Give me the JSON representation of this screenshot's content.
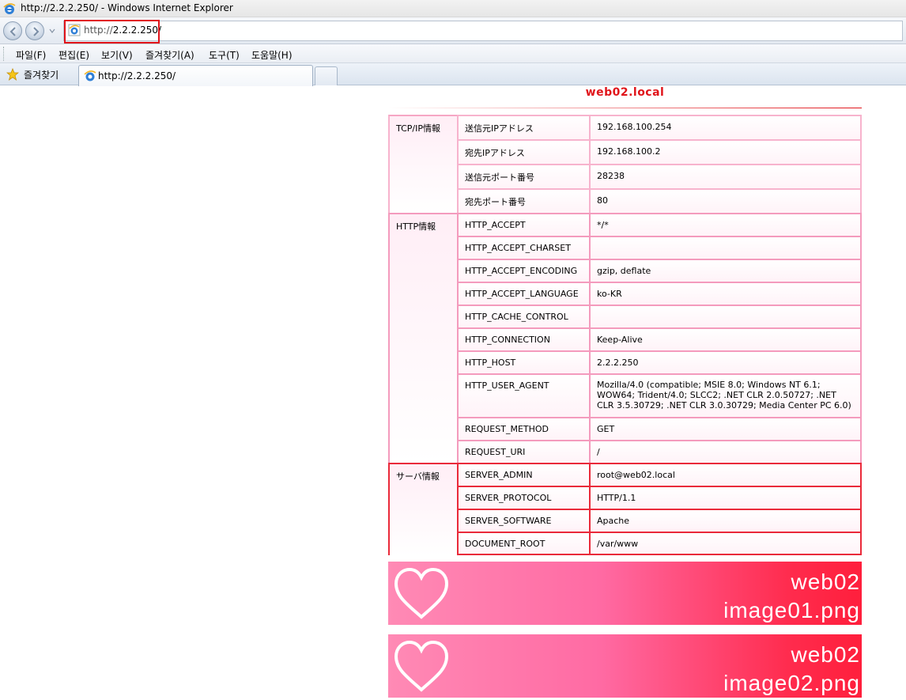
{
  "window": {
    "title": "http://2.2.2.250/ - Windows Internet Explorer"
  },
  "address_bar": {
    "url_scheme": "http://",
    "url_host": "2.2.2.250/"
  },
  "menu": {
    "items": [
      "파일(F)",
      "편집(E)",
      "보기(V)",
      "즐겨찾기(A)",
      "도구(T)",
      "도움말(H)"
    ]
  },
  "favorites": {
    "label": "즐겨찾기"
  },
  "tab": {
    "label": "http://2.2.2.250/"
  },
  "page": {
    "title": "web02.local",
    "sections": {
      "tcp": {
        "label": "TCP/IP情報",
        "rows": [
          {
            "key": "送信元IPアドレス",
            "value": "192.168.100.254"
          },
          {
            "key": "宛先IPアドレス",
            "value": "192.168.100.2"
          },
          {
            "key": "送信元ポート番号",
            "value": "28238"
          },
          {
            "key": "宛先ポート番号",
            "value": "80"
          }
        ]
      },
      "http": {
        "label": "HTTP情報",
        "rows": [
          {
            "key": "HTTP_ACCEPT",
            "value": "*/*"
          },
          {
            "key": "HTTP_ACCEPT_CHARSET",
            "value": ""
          },
          {
            "key": "HTTP_ACCEPT_ENCODING",
            "value": "gzip, deflate"
          },
          {
            "key": "HTTP_ACCEPT_LANGUAGE",
            "value": "ko-KR"
          },
          {
            "key": "HTTP_CACHE_CONTROL",
            "value": ""
          },
          {
            "key": "HTTP_CONNECTION",
            "value": "Keep-Alive"
          },
          {
            "key": "HTTP_HOST",
            "value": "2.2.2.250"
          },
          {
            "key": "HTTP_USER_AGENT",
            "value": "Mozilla/4.0 (compatible; MSIE 8.0; Windows NT 6.1; WOW64; Trident/4.0; SLCC2; .NET CLR 2.0.50727; .NET CLR 3.5.30729; .NET CLR 3.0.30729; Media Center PC 6.0)"
          },
          {
            "key": "REQUEST_METHOD",
            "value": "GET"
          },
          {
            "key": "REQUEST_URI",
            "value": "/"
          }
        ]
      },
      "server": {
        "label": "サーバ情報",
        "rows": [
          {
            "key": "SERVER_ADMIN",
            "value": "root@web02.local"
          },
          {
            "key": "SERVER_PROTOCOL",
            "value": "HTTP/1.1"
          },
          {
            "key": "SERVER_SOFTWARE",
            "value": "Apache"
          },
          {
            "key": "DOCUMENT_ROOT",
            "value": "/var/www"
          }
        ]
      }
    },
    "banners": [
      {
        "line1": "web02",
        "line2": "image01.png"
      },
      {
        "line1": "web02",
        "line2": "image02.png"
      }
    ]
  },
  "colors": {
    "accent_red": "#e0141a",
    "pink_border": "#f6a6c4",
    "server_border": "#ea2a3a"
  },
  "icons": [
    "ie-icon",
    "back-icon",
    "forward-icon",
    "star-icon",
    "heart-icon"
  ]
}
